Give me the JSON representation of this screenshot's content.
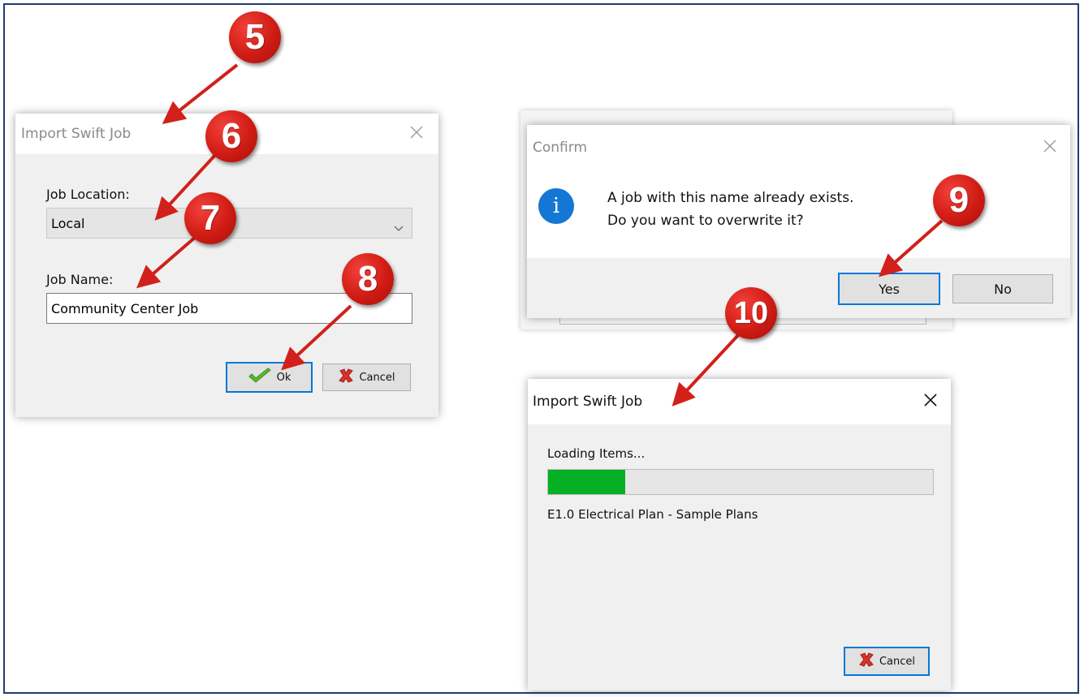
{
  "import_dialog": {
    "title": "Import Swift Job",
    "job_location_label": "Job Location:",
    "job_location_value": "Local",
    "job_name_label": "Job Name:",
    "job_name_value": "Community Center Job",
    "ok_label": "Ok",
    "cancel_label": "Cancel"
  },
  "confirm_dialog": {
    "title": "Confirm",
    "message_line1": "A job with this name already exists.",
    "message_line2": "Do you want to overwrite it?",
    "yes_label": "Yes",
    "no_label": "No"
  },
  "progress_dialog": {
    "title": "Import Swift Job",
    "status_text": "Loading Items...",
    "progress_fraction": 0.2,
    "current_item": "E1.0 Electrical Plan - Sample Plans",
    "cancel_label": "Cancel"
  },
  "step_badges": [
    "5",
    "6",
    "7",
    "8",
    "9",
    "10"
  ],
  "colors": {
    "badge_red": "#d2201a",
    "progress_green": "#06b025",
    "accent_blue": "#0078d7",
    "frame_border": "#1f3e72"
  },
  "icons": [
    "close-icon",
    "chevron-down-icon",
    "checkmark-icon",
    "cancel-x-icon",
    "info-icon"
  ]
}
